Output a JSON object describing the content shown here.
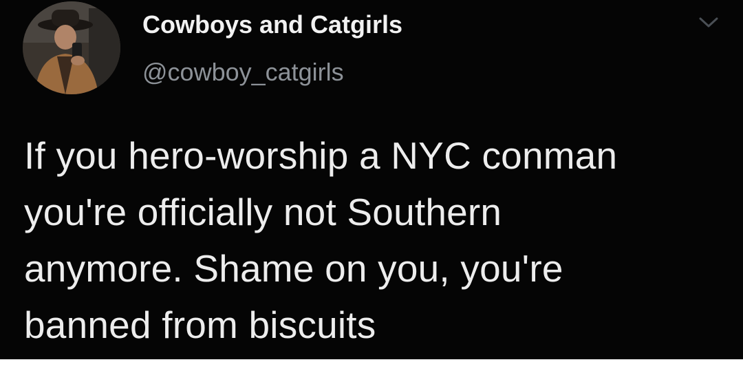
{
  "tweet": {
    "display_name": "Cowboys and Catgirls",
    "handle": "@cowboy_catgirls",
    "text": "If you hero-worship a NYC conman\nyou're officially not Southern\nanymore. Shame on you, you're\nbanned from biscuits",
    "avatar_icon": "profile-photo-avatar",
    "menu_icon": "chevron-down-icon"
  },
  "colors": {
    "background": "#050505",
    "name": "#f2f2f2",
    "handle": "#8d9298",
    "text": "#ededed"
  }
}
